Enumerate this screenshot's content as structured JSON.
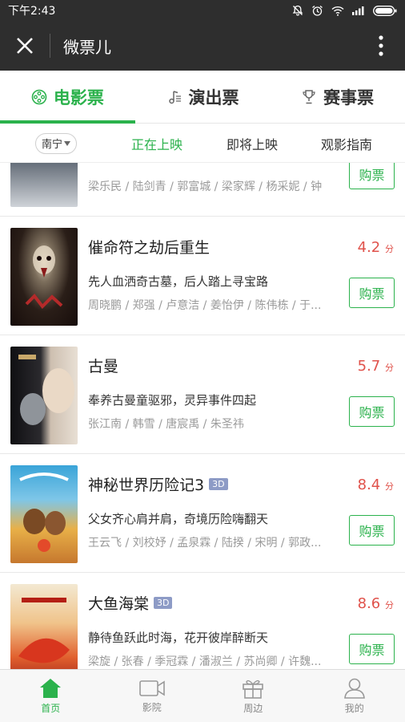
{
  "statusbar": {
    "time": "下午2:43"
  },
  "titlebar": {
    "title": "微票儿"
  },
  "category_tabs": [
    {
      "label": "电影票",
      "icon": "film-reel-icon",
      "active": true
    },
    {
      "label": "演出票",
      "icon": "music-note-icon",
      "active": false
    },
    {
      "label": "赛事票",
      "icon": "trophy-icon",
      "active": false
    }
  ],
  "city": {
    "label": "南宁"
  },
  "sub_tabs": [
    {
      "label": "正在上映",
      "active": true
    },
    {
      "label": "即将上映",
      "active": false
    },
    {
      "label": "观影指南",
      "active": false
    }
  ],
  "buy_label": "购票",
  "score_unit": "分",
  "badge_3d": "3D",
  "movies": [
    {
      "title": "",
      "score": "",
      "desc": "",
      "cast": "梁乐民 / 陆剑青 / 郭富城 / 梁家辉 / 杨采妮 / 钟",
      "partial": true
    },
    {
      "title": "催命符之劫后重生",
      "score": "4.2",
      "desc": "先人血洒奇古墓，后人踏上寻宝路",
      "cast": "周晓鹏 / 郑强 / 卢意洁 / 姜怡伊 / 陈伟栋 / 于...",
      "is3d": false
    },
    {
      "title": "古曼",
      "score": "5.7",
      "desc": "奉养古曼童驱邪，灵异事件四起",
      "cast": "张江南 / 韩雪 / 唐宸禹 / 朱圣祎",
      "is3d": false
    },
    {
      "title": "神秘世界历险记3",
      "score": "8.4",
      "desc": "父女齐心肩并肩，奇境历险嗨翻天",
      "cast": "王云飞 / 刘校妤 / 孟泉霖 / 陆揆 / 宋明 / 郭政...",
      "is3d": true
    },
    {
      "title": "大鱼海棠",
      "score": "8.6",
      "desc": "静待鱼跃此时海，花开彼岸醉断天",
      "cast": "梁旋 / 张春 / 季冠霖 / 潘淑兰 / 苏尚卿 / 许魏...",
      "is3d": true
    }
  ],
  "bottom_nav": [
    {
      "label": "首页",
      "icon": "home-icon",
      "active": true
    },
    {
      "label": "影院",
      "icon": "video-camera-icon",
      "active": false
    },
    {
      "label": "周边",
      "icon": "gift-icon",
      "active": false
    },
    {
      "label": "我的",
      "icon": "user-icon",
      "active": false
    }
  ],
  "colors": {
    "accent": "#2bb24c",
    "score": "#e0524b",
    "header": "#2e2e2e"
  }
}
